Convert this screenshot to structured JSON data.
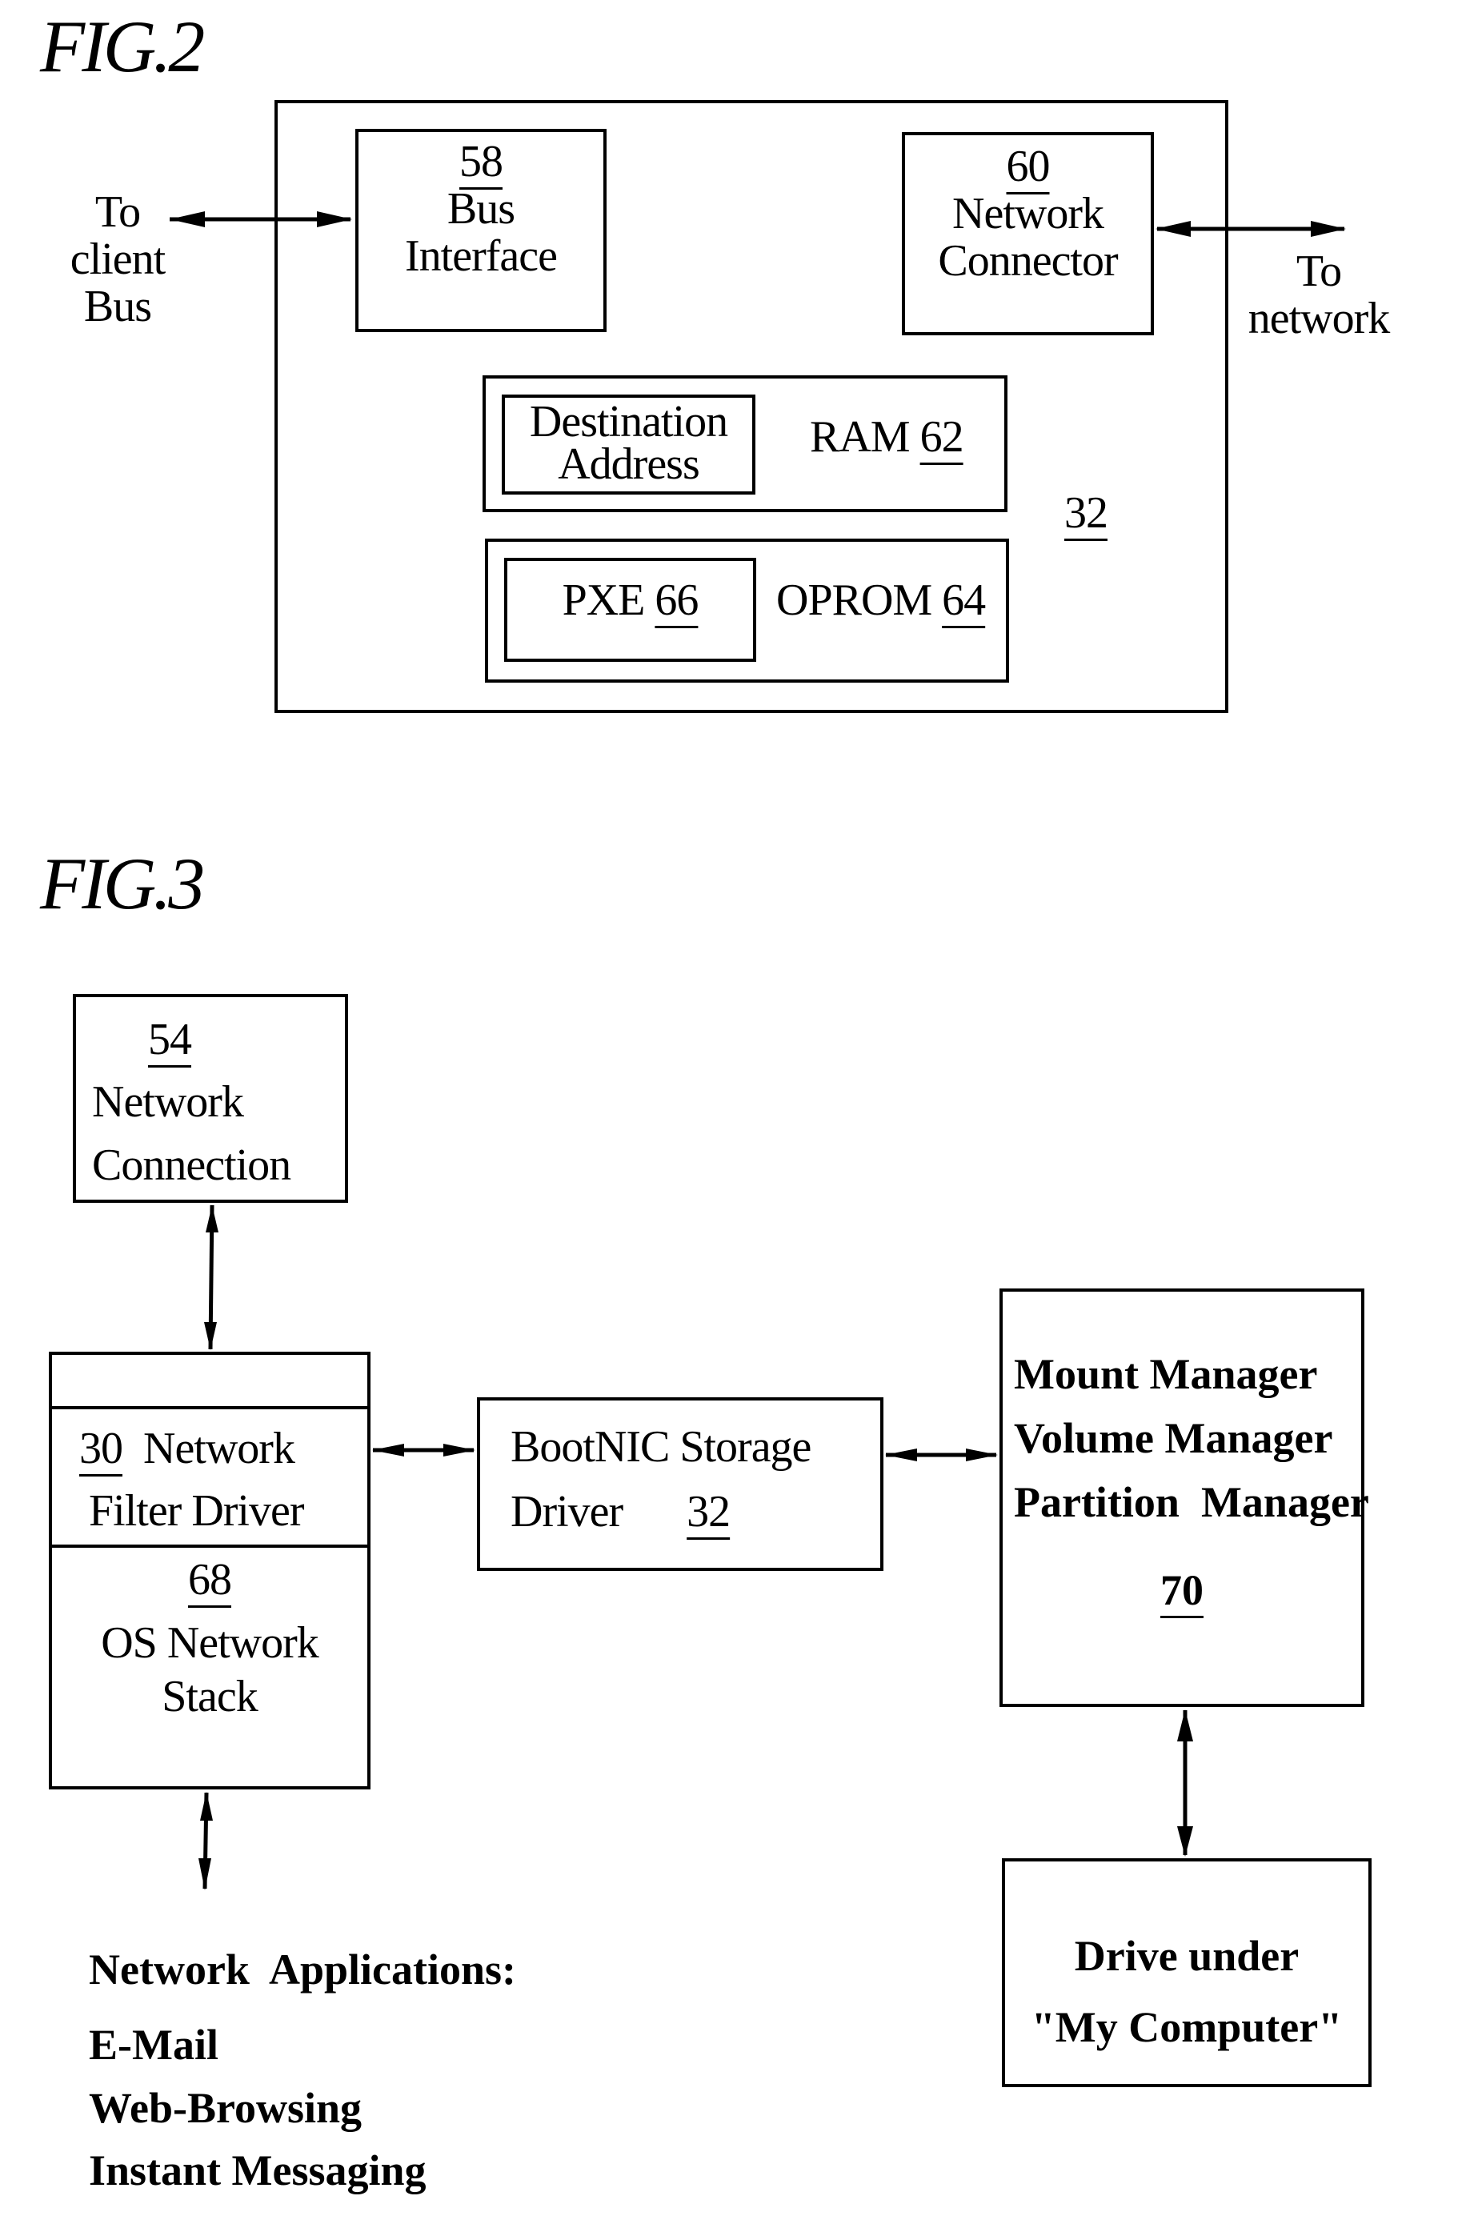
{
  "fig2": {
    "title": "FIG.2",
    "outer_ref": "32",
    "left_label": [
      "To",
      "client",
      "Bus"
    ],
    "right_label": [
      "To",
      "network"
    ],
    "bus_interface": {
      "ref": "58",
      "lines": [
        "Bus",
        "Interface"
      ]
    },
    "network_connector": {
      "ref": "60",
      "lines": [
        "Network",
        "Connector"
      ]
    },
    "ram": {
      "label": "RAM",
      "ref": "62",
      "inner_lines": [
        "Destination",
        "Address"
      ]
    },
    "oprom": {
      "label": "OPROM",
      "ref": "64",
      "inner_label": "PXE",
      "inner_ref": "66"
    }
  },
  "fig3": {
    "title": "FIG.3",
    "network_connection": {
      "ref": "54",
      "lines": [
        "Network",
        "Connection"
      ]
    },
    "filter_driver": {
      "ref": "30",
      "line1": "Network",
      "line2": "Filter Driver"
    },
    "os_stack": {
      "ref": "68",
      "lines": [
        "OS Network",
        "Stack"
      ]
    },
    "bootnic": {
      "line1": "BootNIC Storage",
      "line2": "Driver",
      "ref": "32"
    },
    "managers": {
      "lines": [
        "Mount Manager",
        "Volume Manager",
        "Partition  Manager"
      ],
      "ref": "70"
    },
    "drive": {
      "lines": [
        "Drive under",
        "\"My Computer\""
      ]
    },
    "applications": {
      "heading": "Network  Applications:",
      "items": [
        "E-Mail",
        "Web-Browsing",
        "Instant Messaging"
      ]
    }
  }
}
